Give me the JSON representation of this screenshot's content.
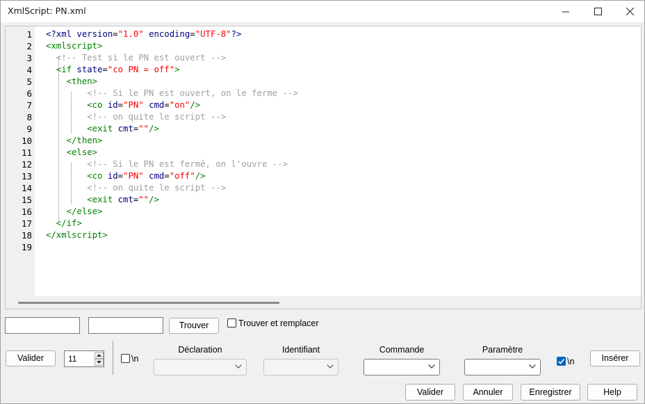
{
  "window": {
    "title": "XmlScript: PN.xml"
  },
  "editor": {
    "line_numbers": [
      "1",
      "2",
      "3",
      "4",
      "5",
      "6",
      "7",
      "8",
      "9",
      "10",
      "11",
      "12",
      "13",
      "14",
      "15",
      "16",
      "17",
      "18",
      "19"
    ],
    "lines": [
      [
        [
          "pi",
          "<?xml "
        ],
        [
          "attr",
          "version"
        ],
        [
          "pun",
          "="
        ],
        [
          "str",
          "\"1.0\""
        ],
        [
          "attr",
          " encoding"
        ],
        [
          "pun",
          "="
        ],
        [
          "str",
          "\"UTF-8\""
        ],
        [
          "pi",
          "?>"
        ]
      ],
      [
        [
          "tag",
          "<xmlscript>"
        ]
      ],
      [
        [
          "com",
          "  <!-- Test si le PN est ouvert -->"
        ]
      ],
      [
        [
          "tag",
          "  <if "
        ],
        [
          "attr",
          "state"
        ],
        [
          "pun",
          "="
        ],
        [
          "str",
          "\"co PN = off\""
        ],
        [
          "tag",
          ">"
        ]
      ],
      [
        [
          "tag",
          "    <then>"
        ]
      ],
      [
        [
          "com",
          "        <!-- Si le PN est ouvert, on le ferme -->"
        ]
      ],
      [
        [
          "tag",
          "        <co "
        ],
        [
          "attr",
          "id"
        ],
        [
          "pun",
          "="
        ],
        [
          "str",
          "\"PN\""
        ],
        [
          "attr",
          " cmd"
        ],
        [
          "pun",
          "="
        ],
        [
          "str",
          "\"on\""
        ],
        [
          "tag",
          "/>"
        ]
      ],
      [
        [
          "com",
          "        <!-- on quite le script -->"
        ]
      ],
      [
        [
          "tag",
          "        <exit "
        ],
        [
          "attr",
          "cmt"
        ],
        [
          "pun",
          "="
        ],
        [
          "str",
          "\"\""
        ],
        [
          "tag",
          "/>"
        ]
      ],
      [
        [
          "tag",
          "    </then>"
        ]
      ],
      [
        [
          "tag",
          "    <else>"
        ]
      ],
      [
        [
          "com",
          "        <!-- Si le PN est fermé, on l'ouvre -->"
        ]
      ],
      [
        [
          "tag",
          "        <co "
        ],
        [
          "attr",
          "id"
        ],
        [
          "pun",
          "="
        ],
        [
          "str",
          "\"PN\""
        ],
        [
          "attr",
          " cmd"
        ],
        [
          "pun",
          "="
        ],
        [
          "str",
          "\"off\""
        ],
        [
          "tag",
          "/>"
        ]
      ],
      [
        [
          "com",
          "        <!-- on quite le script -->"
        ]
      ],
      [
        [
          "tag",
          "        <exit "
        ],
        [
          "attr",
          "cmt"
        ],
        [
          "pun",
          "="
        ],
        [
          "str",
          "\"\""
        ],
        [
          "tag",
          "/>"
        ]
      ],
      [
        [
          "tag",
          "    </else>"
        ]
      ],
      [
        [
          "tag",
          "  </if>"
        ]
      ],
      [
        [
          "tag",
          "</xmlscript>"
        ]
      ],
      []
    ]
  },
  "search": {
    "find_value": "",
    "replace_value": "",
    "find_button": "Trouver",
    "find_replace_label": "Trouver et remplacer",
    "find_replace_checked": false
  },
  "insert": {
    "validate_button": "Valider",
    "indent_value": "11",
    "newline_left_label": "\\n",
    "newline_left_checked": false,
    "col_declaration": "Déclaration",
    "col_identifier": "Identifiant",
    "col_command": "Commande",
    "col_parameter": "Paramètre",
    "newline_right_label": "\\n",
    "newline_right_checked": true,
    "insert_button": "Insérer"
  },
  "footer": {
    "ok_button": "Valider",
    "cancel_button": "Annuler",
    "save_button": "Enregistrer",
    "help_button": "Help"
  },
  "colors": {
    "tag": "#008000",
    "attribute": "#00007f",
    "string": "#ff0000",
    "comment": "#a0a0a0",
    "accent": "#0067c0"
  }
}
